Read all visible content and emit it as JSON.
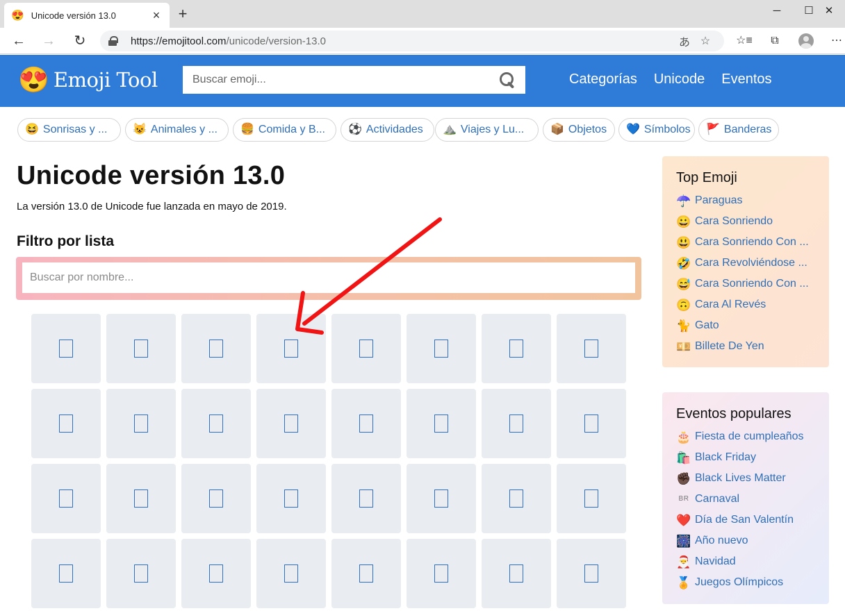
{
  "browser": {
    "tab_title": "Unicode versión 13.0",
    "tab_favicon": "😍",
    "url_host": "https://emojitool.com",
    "url_path": "/unicode/version-13.0"
  },
  "site": {
    "logo_emoji": "😍",
    "logo_text": "Emoji Tool",
    "search_placeholder": "Buscar emoji...",
    "nav": [
      "Categorías",
      "Unicode",
      "Eventos"
    ],
    "brand_color": "#2f7bd8"
  },
  "categories": [
    {
      "emoji": "😆",
      "label": "Sonrisas y ..."
    },
    {
      "emoji": "😺",
      "label": "Animales y ..."
    },
    {
      "emoji": "🍔",
      "label": "Comida y B..."
    },
    {
      "emoji": "⚽",
      "label": "Actividades"
    },
    {
      "emoji": "⛰️",
      "label": "Viajes y Lu..."
    },
    {
      "emoji": "📦",
      "label": "Objetos"
    },
    {
      "emoji": "💙",
      "label": "Símbolos"
    },
    {
      "emoji": "🚩",
      "label": "Banderas"
    }
  ],
  "main": {
    "title": "Unicode versión 13.0",
    "lead": "La versión 13.0 de Unicode fue lanzada en mayo de 2019.",
    "filter_heading": "Filtro por lista",
    "filter_placeholder": "Buscar por nombre..."
  },
  "emoji_grid": {
    "rows": 4,
    "columns": 8,
    "glyph": "missing-glyph-box"
  },
  "sidebar": {
    "top_title": "Top Emoji",
    "top_items": [
      {
        "emoji": "☂️",
        "label": "Paraguas"
      },
      {
        "emoji": "😀",
        "label": "Cara Sonriendo"
      },
      {
        "emoji": "😃",
        "label": "Cara Sonriendo Con ..."
      },
      {
        "emoji": "🤣",
        "label": "Cara Revolviéndose ..."
      },
      {
        "emoji": "😅",
        "label": "Cara Sonriendo Con ..."
      },
      {
        "emoji": "🙃",
        "label": "Cara Al Revés"
      },
      {
        "emoji": "🐈",
        "label": "Gato"
      },
      {
        "emoji": "💴",
        "label": "Billete De Yen"
      }
    ],
    "events_title": "Eventos populares",
    "event_items": [
      {
        "emoji": "🎂",
        "label": "Fiesta de cumpleaños"
      },
      {
        "emoji": "🛍️",
        "label": "Black Friday"
      },
      {
        "emoji": "✊🏿",
        "label": "Black Lives Matter"
      },
      {
        "emoji": "BR",
        "label": "Carnaval"
      },
      {
        "emoji": "❤️",
        "label": "Día de San Valentín"
      },
      {
        "emoji": "🎆",
        "label": "Año nuevo"
      },
      {
        "emoji": "🎅",
        "label": "Navidad"
      },
      {
        "emoji": "🏅",
        "label": "Juegos Olímpicos"
      }
    ]
  },
  "annotation": {
    "arrow_color": "#f01414"
  }
}
